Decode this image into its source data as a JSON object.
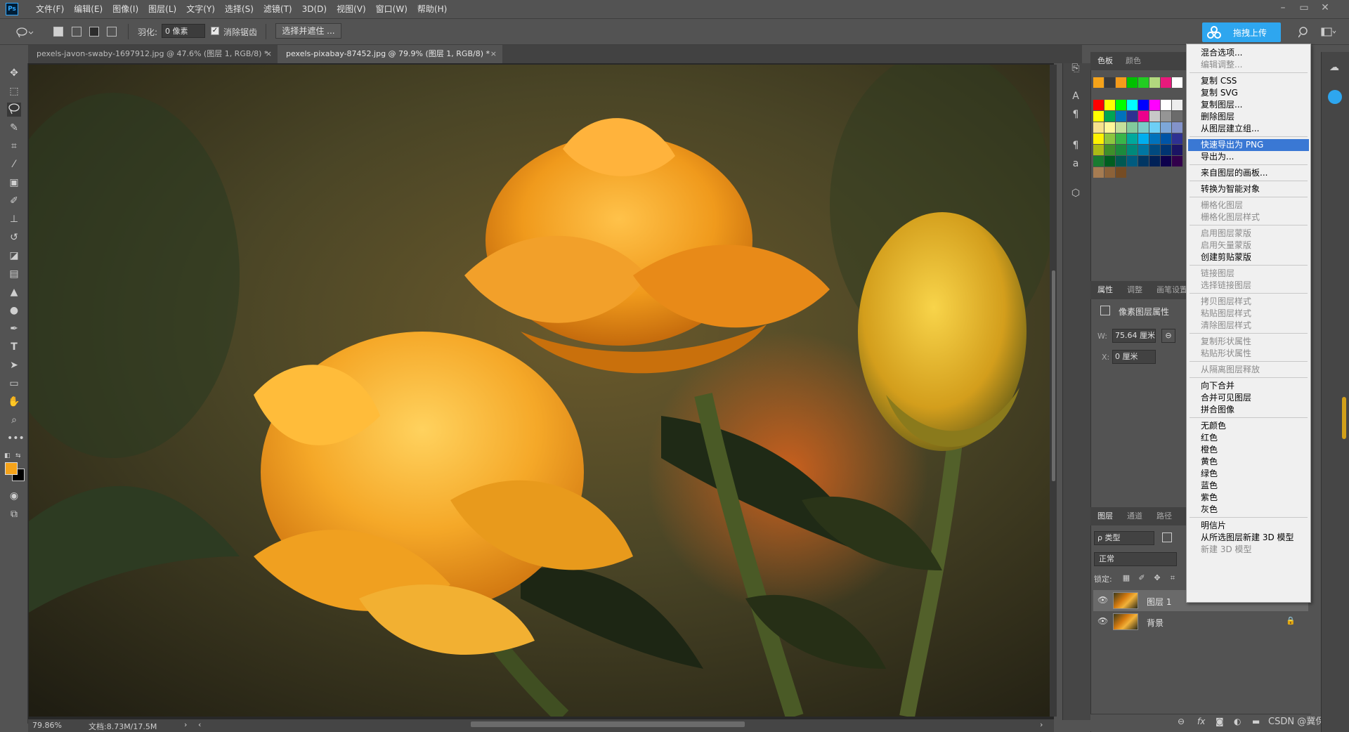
{
  "menubar": {
    "items": [
      "文件(F)",
      "编辑(E)",
      "图像(I)",
      "图层(L)",
      "文字(Y)",
      "选择(S)",
      "滤镜(T)",
      "3D(D)",
      "视图(V)",
      "窗口(W)",
      "帮助(H)"
    ],
    "logo": "Ps"
  },
  "window_controls": {
    "minimize": "–",
    "restore": "▭",
    "close": "✕"
  },
  "options": {
    "feather_label": "羽化:",
    "feather_value": "0 像素",
    "antialias_checked": "✓",
    "antialias_label": "消除锯齿",
    "select_mask_label": "选择并遮住 ..."
  },
  "upload": {
    "label": "拖拽上传"
  },
  "tabs": [
    {
      "label": "pexels-javon-swaby-1697912.jpg @ 47.6% (图层 1, RGB/8) *",
      "close": "×"
    },
    {
      "label": "pexels-pixabay-87452.jpg @ 79.9% (图层 1, RGB/8) *",
      "close": "×"
    }
  ],
  "status": {
    "zoom": "79.86%",
    "doc": "文档:8.73M/17.5M",
    "arrow": "›",
    "arrow_left": "‹",
    "arrow_right": "›"
  },
  "swatches_panel": {
    "tabs": [
      "色板",
      "颜色"
    ]
  },
  "properties_panel": {
    "tabs": [
      "属性",
      "调整",
      "画笔设置"
    ],
    "title": "像素图层属性",
    "w_label": "W:",
    "w_value": "75.64 厘米",
    "link_icon": "⊖",
    "x_label": "X:",
    "x_value": "0 厘米"
  },
  "layers_panel": {
    "tabs": [
      "图层",
      "通道",
      "路径"
    ],
    "kind_filter": "ρ 类型",
    "blend_mode": "正常",
    "lock_label": "锁定:",
    "layers": [
      {
        "name": "图层 1",
        "visible": "👁",
        "lock": ""
      },
      {
        "name": "背景",
        "visible": "👁",
        "lock": "🔒"
      }
    ]
  },
  "watermark": "CSDN @冀保清",
  "context_menu": {
    "groups": [
      [
        {
          "label": "混合选项...",
          "enabled": true
        },
        {
          "label": "编辑调整...",
          "enabled": false
        }
      ],
      [
        {
          "label": "复制 CSS",
          "enabled": true
        },
        {
          "label": "复制 SVG",
          "enabled": true
        },
        {
          "label": "复制图层...",
          "enabled": true
        },
        {
          "label": "删除图层",
          "enabled": true
        },
        {
          "label": "从图层建立组...",
          "enabled": true
        }
      ],
      [
        {
          "label": "快速导出为 PNG",
          "enabled": true,
          "highlight": true
        },
        {
          "label": "导出为...",
          "enabled": true
        }
      ],
      [
        {
          "label": "来自图层的画板...",
          "enabled": true
        }
      ],
      [
        {
          "label": "转换为智能对象",
          "enabled": true
        }
      ],
      [
        {
          "label": "栅格化图层",
          "enabled": false
        },
        {
          "label": "栅格化图层样式",
          "enabled": false
        }
      ],
      [
        {
          "label": "启用图层蒙版",
          "enabled": false
        },
        {
          "label": "启用矢量蒙版",
          "enabled": false
        },
        {
          "label": "创建剪贴蒙版",
          "enabled": true
        }
      ],
      [
        {
          "label": "链接图层",
          "enabled": false
        },
        {
          "label": "选择链接图层",
          "enabled": false
        }
      ],
      [
        {
          "label": "拷贝图层样式",
          "enabled": false
        },
        {
          "label": "粘贴图层样式",
          "enabled": false
        },
        {
          "label": "清除图层样式",
          "enabled": false
        }
      ],
      [
        {
          "label": "复制形状属性",
          "enabled": false
        },
        {
          "label": "粘贴形状属性",
          "enabled": false
        }
      ],
      [
        {
          "label": "从隔离图层释放",
          "enabled": false
        }
      ],
      [
        {
          "label": "向下合并",
          "enabled": true
        },
        {
          "label": "合并可见图层",
          "enabled": true
        },
        {
          "label": "拼合图像",
          "enabled": true
        }
      ],
      [
        {
          "label": "无颜色",
          "enabled": true
        },
        {
          "label": "红色",
          "enabled": true
        },
        {
          "label": "橙色",
          "enabled": true
        },
        {
          "label": "黄色",
          "enabled": true
        },
        {
          "label": "绿色",
          "enabled": true
        },
        {
          "label": "蓝色",
          "enabled": true
        },
        {
          "label": "紫色",
          "enabled": true
        },
        {
          "label": "灰色",
          "enabled": true
        }
      ],
      [
        {
          "label": "明信片",
          "enabled": true
        },
        {
          "label": "从所选图层新建 3D 模型",
          "enabled": true
        },
        {
          "label": "新建 3D 模型",
          "enabled": false
        }
      ]
    ]
  },
  "colors": {
    "app_bg": "#535353",
    "accent": "#2ea6ef",
    "menu_highlight": "#3a78d4",
    "foreground_swatch": "#f5a31a",
    "background_swatch": "#000000"
  },
  "icons": {
    "tools": [
      "move-icon",
      "marquee-icon",
      "lasso-icon",
      "quick-select-icon",
      "crop-icon",
      "eyedropper-icon",
      "healing-icon",
      "brush-icon",
      "stamp-icon",
      "history-brush-icon",
      "eraser-icon",
      "gradient-icon",
      "blur-icon",
      "dodge-icon",
      "pen-icon",
      "type-icon",
      "path-select-icon",
      "shape-icon",
      "hand-icon",
      "zoom-icon",
      "more-icon"
    ]
  }
}
